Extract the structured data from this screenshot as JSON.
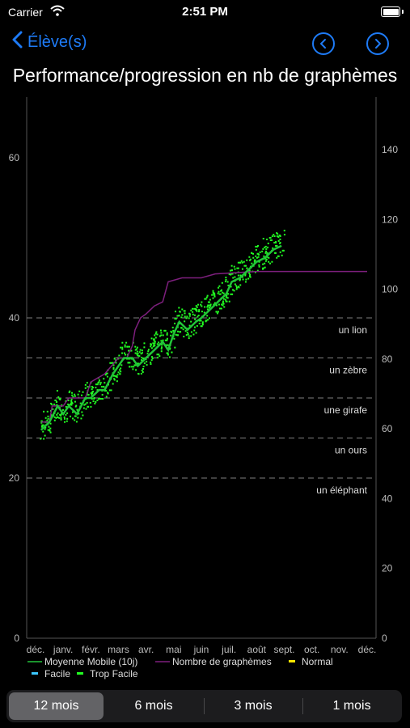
{
  "status": {
    "carrier": "Carrier",
    "time": "2:51 PM"
  },
  "nav": {
    "back_label": "Élève(s)"
  },
  "chart_data": {
    "type": "line",
    "title": "Performance/progression en nb de graphèmes",
    "x_ticks": [
      "déc.",
      "janv.",
      "févr.",
      "mars",
      "avr.",
      "mai",
      "juin",
      "juil.",
      "août",
      "sept.",
      "oct.",
      "nov.",
      "déc."
    ],
    "y_left": {
      "min": 0,
      "max": 60,
      "ticks": [
        0,
        20,
        40,
        60
      ]
    },
    "y_right": {
      "min": 0,
      "max": 140,
      "ticks": [
        0,
        20,
        40,
        60,
        80,
        100,
        120,
        140
      ]
    },
    "reference_lines": [
      {
        "label": "un lion",
        "value": 40
      },
      {
        "label": "un zèbre",
        "value": 35
      },
      {
        "label": "une girafe",
        "value": 30
      },
      {
        "label": "un ours",
        "value": 25
      },
      {
        "label": "un éléphant",
        "value": 20
      }
    ],
    "series": [
      {
        "name": "Moyenne Mobile (10j)",
        "color": "#22c43a",
        "points": [
          [
            0.2,
            26
          ],
          [
            0.5,
            27
          ],
          [
            0.8,
            29
          ],
          [
            1.0,
            28
          ],
          [
            1.2,
            29
          ],
          [
            1.5,
            28
          ],
          [
            1.8,
            30
          ],
          [
            2.0,
            30
          ],
          [
            2.3,
            31
          ],
          [
            2.5,
            31
          ],
          [
            2.8,
            33
          ],
          [
            3.0,
            34
          ],
          [
            3.2,
            35
          ],
          [
            3.5,
            35
          ],
          [
            3.7,
            34
          ],
          [
            4.0,
            35
          ],
          [
            4.3,
            36
          ],
          [
            4.6,
            37
          ],
          [
            4.8,
            36
          ],
          [
            5.0,
            38
          ],
          [
            5.2,
            39.5
          ],
          [
            5.5,
            38.5
          ],
          [
            5.8,
            39.5
          ],
          [
            6.0,
            40
          ],
          [
            6.3,
            41
          ],
          [
            6.6,
            42
          ],
          [
            6.9,
            43
          ],
          [
            7.1,
            44.5
          ],
          [
            7.4,
            45
          ],
          [
            7.7,
            46
          ],
          [
            8.0,
            47
          ],
          [
            8.3,
            47.5
          ],
          [
            8.6,
            48.5
          ],
          [
            8.9,
            49
          ]
        ]
      },
      {
        "name": "Nombre de graphèmes",
        "color": "#7d1f7d",
        "points": [
          [
            0.2,
            27
          ],
          [
            0.5,
            27
          ],
          [
            0.6,
            29
          ],
          [
            1.0,
            29
          ],
          [
            1.2,
            30
          ],
          [
            1.8,
            30
          ],
          [
            2.0,
            32
          ],
          [
            2.5,
            33
          ],
          [
            3.0,
            35
          ],
          [
            3.3,
            35
          ],
          [
            3.5,
            36.5
          ],
          [
            3.6,
            38.5
          ],
          [
            3.8,
            40
          ],
          [
            4.0,
            40.5
          ],
          [
            4.3,
            41.5
          ],
          [
            4.6,
            42
          ],
          [
            4.8,
            44.5
          ],
          [
            5.3,
            45
          ],
          [
            6.0,
            45
          ],
          [
            6.5,
            45.5
          ],
          [
            8.0,
            45.8
          ],
          [
            12.0,
            45.8
          ]
        ]
      },
      {
        "name": "Normal",
        "color": "#ffe600",
        "points": []
      },
      {
        "name": "Facile",
        "color": "#3cc8ff",
        "points": []
      },
      {
        "name": "Trop Facile",
        "color": "#22ff22",
        "points": []
      }
    ]
  },
  "periods": [
    "12 mois",
    "6 mois",
    "3 mois",
    "1 mois"
  ],
  "colors": {
    "accent": "#1e7bf6",
    "grid": "#7f7f7f"
  }
}
